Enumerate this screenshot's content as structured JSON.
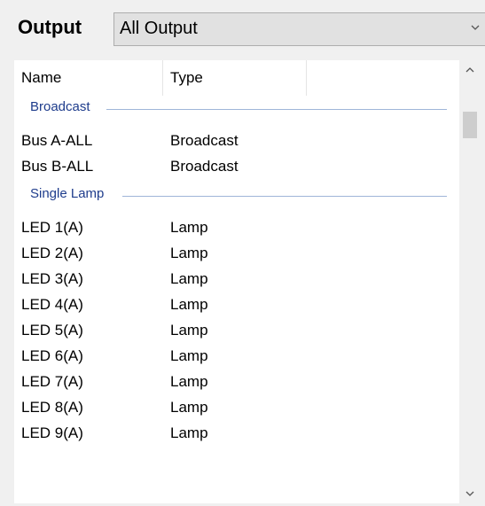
{
  "header": {
    "label": "Output",
    "select_value": "All Output"
  },
  "columns": [
    "Name",
    "Type"
  ],
  "groups": [
    {
      "label": "Broadcast",
      "rows": [
        {
          "name": "Bus A-ALL",
          "type": "Broadcast"
        },
        {
          "name": "Bus B-ALL",
          "type": "Broadcast"
        }
      ]
    },
    {
      "label": "Single Lamp",
      "rows": [
        {
          "name": "LED 1(A)",
          "type": "Lamp"
        },
        {
          "name": "LED 2(A)",
          "type": "Lamp"
        },
        {
          "name": "LED 3(A)",
          "type": "Lamp"
        },
        {
          "name": "LED 4(A)",
          "type": "Lamp"
        },
        {
          "name": "LED 5(A)",
          "type": "Lamp"
        },
        {
          "name": "LED 6(A)",
          "type": "Lamp"
        },
        {
          "name": "LED 7(A)",
          "type": "Lamp"
        },
        {
          "name": "LED 8(A)",
          "type": "Lamp"
        },
        {
          "name": "LED 9(A)",
          "type": "Lamp"
        }
      ]
    }
  ],
  "icons": {
    "dropdown": "chevron-down-icon",
    "scroll_up": "chevron-up-icon",
    "scroll_down": "chevron-down-icon"
  },
  "colors": {
    "group_text": "#1e3c8c",
    "group_line": "#9fb5d8"
  }
}
